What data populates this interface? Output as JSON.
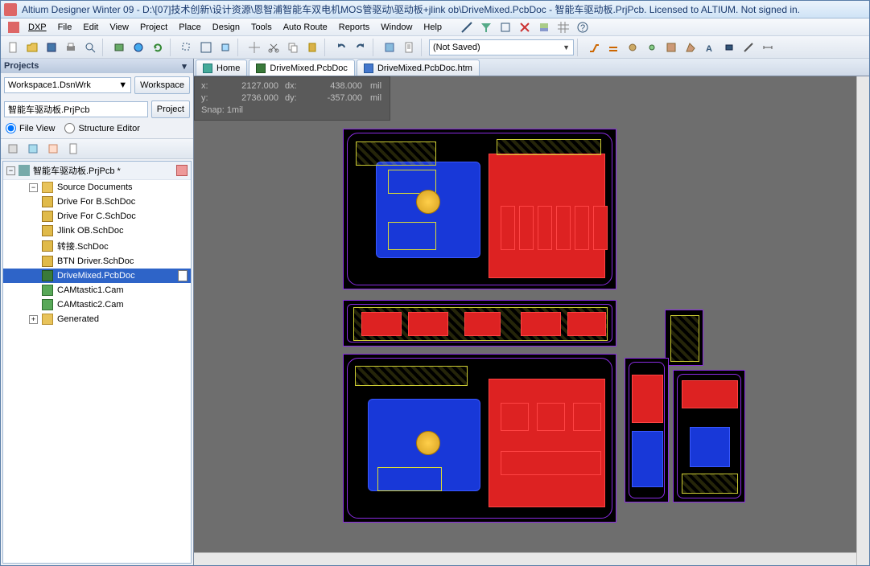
{
  "title": "Altium Designer Winter 09 - D:\\[07]技术创新\\设计资源\\恩智浦智能车双电机MOS管驱动\\驱动板+jlink ob\\DriveMixed.PcbDoc - 智能车驱动板.PrjPcb. Licensed to ALTIUM. Not signed in.",
  "menus": {
    "dxp": "DXP",
    "file": "File",
    "edit": "Edit",
    "view": "View",
    "project": "Project",
    "place": "Place",
    "design": "Design",
    "tools": "Tools",
    "autoroute": "Auto Route",
    "reports": "Reports",
    "window": "Window",
    "help": "Help"
  },
  "toolbar": {
    "notsaved": "(Not Saved)"
  },
  "panel": {
    "title": "Projects",
    "workspace_value": "Workspace1.DsnWrk",
    "workspace_btn": "Workspace",
    "project_value": "智能车驱动板.PrjPcb",
    "project_btn": "Project",
    "fileview": "File View",
    "structure": "Structure Editor"
  },
  "tree": {
    "root": "智能车驱动板.PrjPcb *",
    "src": "Source Documents",
    "items": [
      "Drive For B.SchDoc",
      "Drive For C.SchDoc",
      "Jlink OB.SchDoc",
      "转接.SchDoc",
      "BTN Driver.SchDoc",
      "DriveMixed.PcbDoc",
      "CAMtastic1.Cam",
      "CAMtastic2.Cam"
    ],
    "gen": "Generated"
  },
  "doctabs": {
    "home": "Home",
    "pcb": "DriveMixed.PcbDoc",
    "htm": "DriveMixed.PcbDoc.htm"
  },
  "hud": {
    "x_lbl": "x:",
    "x_val": "2127.000",
    "dx_lbl": "dx:",
    "dx_val": "438.000",
    "unit": "mil",
    "y_lbl": "y:",
    "y_val": "2736.000",
    "dy_lbl": "dy:",
    "dy_val": "-357.000",
    "snap": "Snap: 1mil"
  }
}
